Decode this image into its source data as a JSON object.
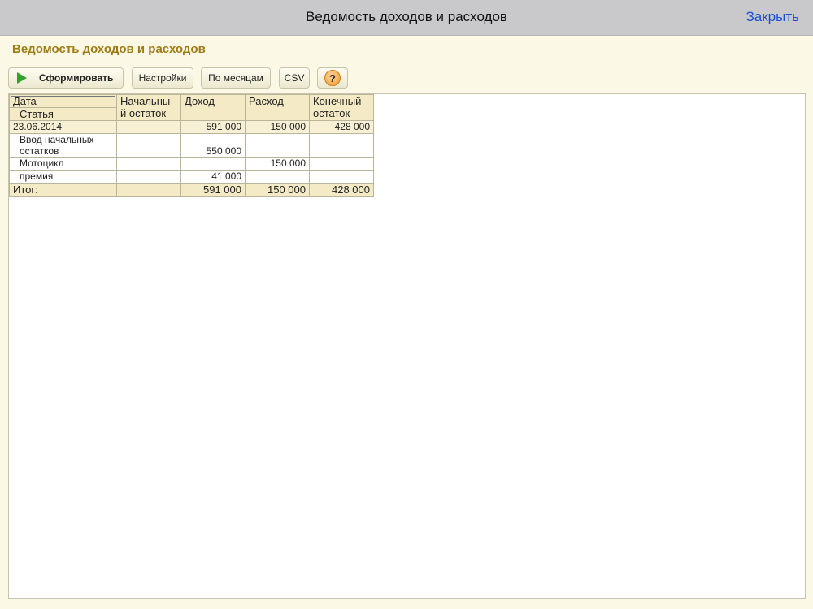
{
  "window": {
    "title": "Ведомость доходов и расходов",
    "close_label": "Закрыть"
  },
  "form": {
    "header": "Ведомость доходов и расходов"
  },
  "toolbar": {
    "run_label": "Сформировать",
    "settings_label": "Настройки",
    "months_label": "По месяцам",
    "csv_label": "CSV",
    "help_label": "?"
  },
  "table": {
    "headers": {
      "date": "Дата",
      "article": "Статья",
      "opening_1": "Начальны",
      "opening_2": "й остаток",
      "income": "Доход",
      "expense": "Расход",
      "closing_1": "Конечный",
      "closing_2": "остаток"
    },
    "group": {
      "label": "23.06.2014",
      "opening": "",
      "income": "591 000",
      "expense": "150 000",
      "closing": "428 000"
    },
    "rows": [
      {
        "label_1": "Ввод начальных",
        "label_2": "остатков",
        "opening": "",
        "income": "550 000",
        "expense": "",
        "closing": ""
      },
      {
        "label_1": "Мотоцикл",
        "opening": "",
        "income": "",
        "expense": "150 000",
        "closing": ""
      },
      {
        "label_1": "премия",
        "opening": "",
        "income": "41 000",
        "expense": "",
        "closing": ""
      }
    ],
    "total": {
      "label": "Итог:",
      "opening": "",
      "income": "591 000",
      "expense": "150 000",
      "closing": "428 000"
    }
  },
  "colors": {
    "accent": "#9c7a14",
    "header_bg": "#f4ebc6",
    "link": "#1d4fd6",
    "run_icon": "#35a02b"
  },
  "icons": {
    "run": "play-icon",
    "help": "help-icon"
  }
}
